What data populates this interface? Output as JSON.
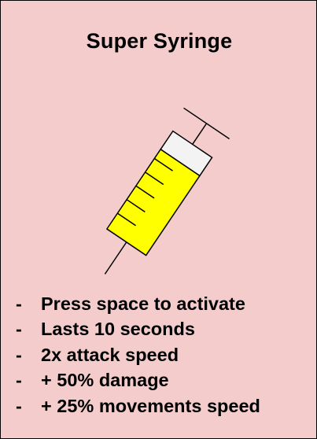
{
  "card": {
    "title": "Super Syringe",
    "background_color": "#f4cccc",
    "border_color": "#000000"
  },
  "illustration": {
    "icon": "syringe-icon",
    "barrel_fill_color": "#ffff00",
    "cap_fill_color": "#f3f3f3",
    "outline_color": "#000000"
  },
  "features": {
    "bullet": "-",
    "items": [
      "Press space to activate",
      "Lasts 10 seconds",
      "2x attack speed",
      "+ 50% damage",
      "+ 25% movements speed"
    ]
  }
}
